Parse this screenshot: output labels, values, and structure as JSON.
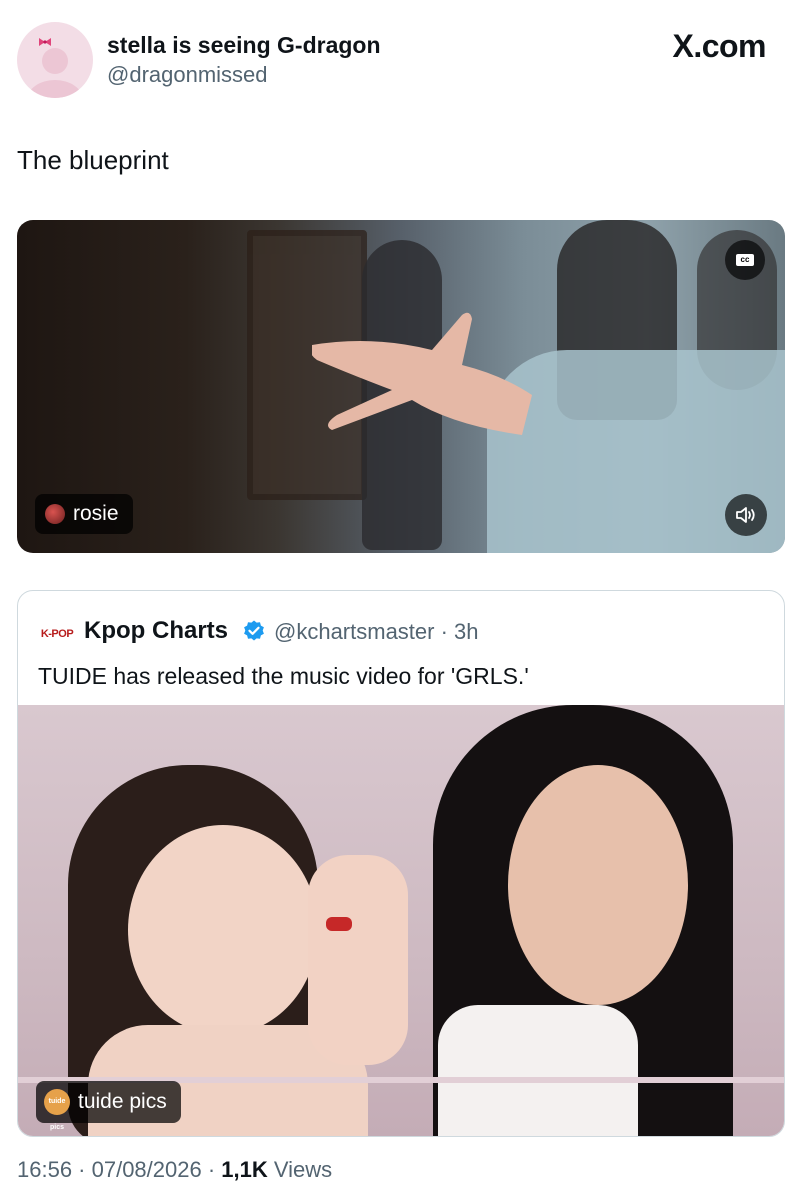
{
  "author": {
    "display_name": "stella is seeing G-dragon",
    "handle": "@dragonmissed"
  },
  "brand": {
    "logo_text": "X.com"
  },
  "tweet": {
    "text": "The blueprint"
  },
  "video": {
    "cc_label": "cc",
    "attribution": "rosie",
    "icons": [
      "cc-icon",
      "speaker-icon"
    ]
  },
  "quote": {
    "avatar_text": "K-POP",
    "display_name": "Kpop Charts",
    "handle_time": "@kchartsmaster · 3h",
    "text": "TUIDE has released the music video for 'GRLS.'",
    "image_attribution": "tuide pics",
    "image_attribution_avatar": "tuide pics"
  },
  "footer": {
    "time_date": "16:56 · 07/08/2026 · ",
    "views_count": "1,1K",
    "views_label": " Views"
  },
  "colors": {
    "text_primary": "#0f1419",
    "text_secondary": "#536471",
    "border": "#cfd9de",
    "verified": "#1d9bf0"
  }
}
